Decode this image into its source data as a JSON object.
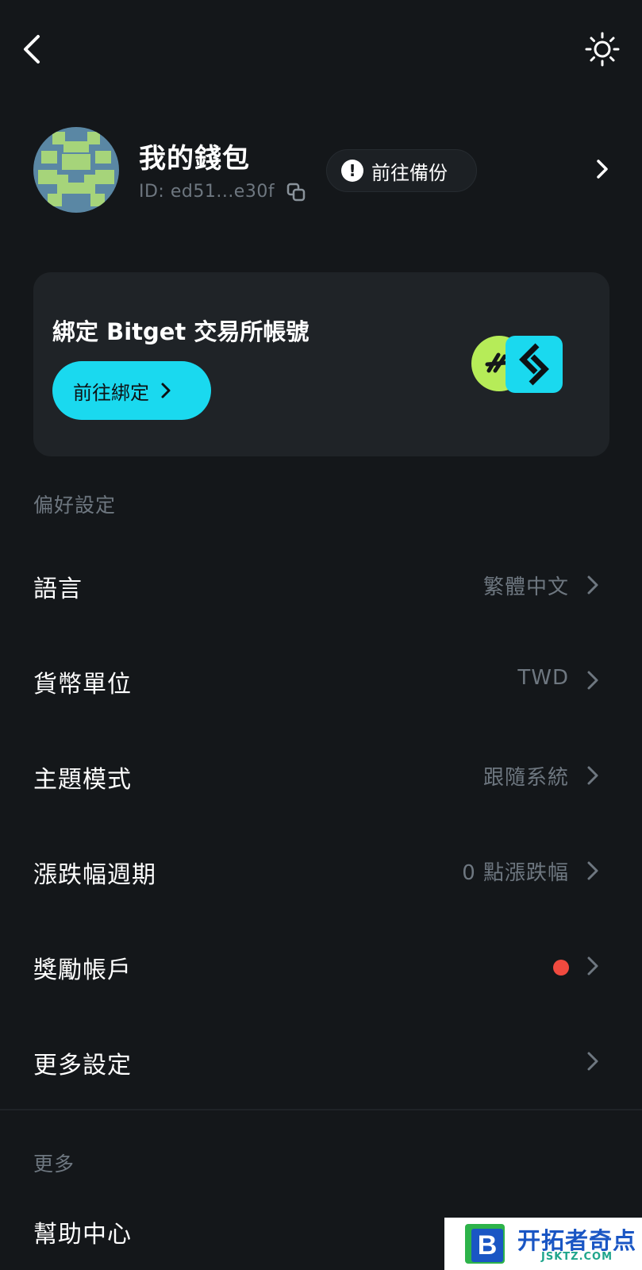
{
  "header": {
    "back_icon": "chevron-left-icon",
    "theme_icon": "sun-icon"
  },
  "profile": {
    "wallet_name": "我的錢包",
    "wallet_id": "ID: ed51...e30f",
    "copy_icon": "copy-icon",
    "backup_label": "前往備份",
    "backup_icon": "exclamation-icon",
    "avatar_colors": {
      "bg": "#5a87a4",
      "fg": "#a6d47a"
    }
  },
  "bind_card": {
    "title": "綁定 Bitget 交易所帳號",
    "button_label": "前往綁定",
    "accent": "#1ad9ef",
    "logo_green": "#b6ec58"
  },
  "preferences": {
    "section_label": "偏好設定",
    "items": [
      {
        "label": "語言",
        "value": "繁體中文"
      },
      {
        "label": "貨幣單位",
        "value": "TWD"
      },
      {
        "label": "主題模式",
        "value": "跟隨系統"
      },
      {
        "label": "漲跌幅週期",
        "value": "0 點漲跌幅"
      },
      {
        "label": "獎勵帳戶",
        "value": "",
        "badge": "red-dot"
      },
      {
        "label": "更多設定",
        "value": ""
      }
    ]
  },
  "more": {
    "section_label": "更多",
    "items": [
      {
        "label": "幫助中心"
      }
    ]
  },
  "watermark": {
    "title": "开拓者奇点",
    "subtitle": "JSKTZ.COM"
  },
  "colors": {
    "background": "#14171a",
    "card": "#1f2327",
    "muted_text": "#6e7780",
    "badge_red": "#f04a3f"
  }
}
